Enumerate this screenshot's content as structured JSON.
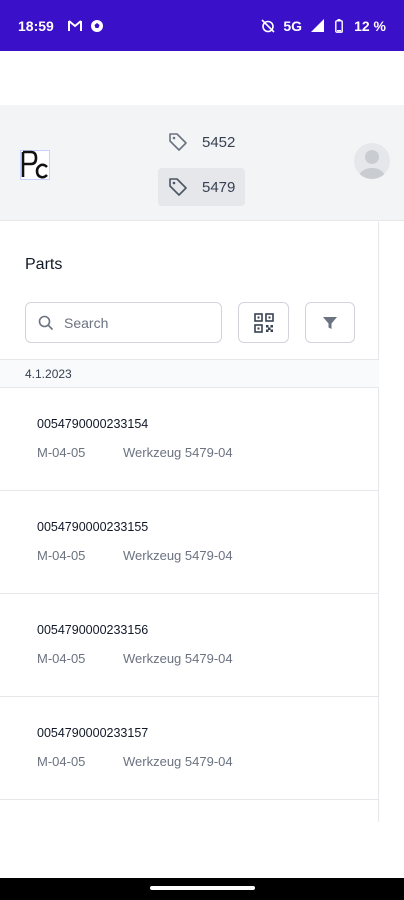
{
  "status_bar": {
    "time": "18:59",
    "left_icons": [
      "gmail-icon",
      "football-icon"
    ],
    "right_icons": [
      "alarm-off-icon",
      "signal-icon",
      "battery-icon"
    ],
    "network": "5G",
    "battery": "12 %",
    "bg_color": "#3a10c9"
  },
  "header": {
    "logo_text": "Pc",
    "tags": [
      {
        "label": "5452",
        "icon": "tag-icon",
        "selected": false
      },
      {
        "label": "5479",
        "icon": "tag-icon",
        "selected": true
      }
    ],
    "avatar_icon": "user-avatar-icon"
  },
  "main": {
    "title": "Parts",
    "search": {
      "placeholder": "Search",
      "value": ""
    },
    "qr_button_icon": "qr-code-icon",
    "filter_button_icon": "filter-icon",
    "date_group": "4.1.2023",
    "parts": [
      {
        "code": "0054790000233154",
        "location": "M-04-05",
        "tool": "Werkzeug 5479-04"
      },
      {
        "code": "0054790000233155",
        "location": "M-04-05",
        "tool": "Werkzeug 5479-04"
      },
      {
        "code": "0054790000233156",
        "location": "M-04-05",
        "tool": "Werkzeug 5479-04"
      },
      {
        "code": "0054790000233157",
        "location": "M-04-05",
        "tool": "Werkzeug 5479-04"
      }
    ]
  }
}
